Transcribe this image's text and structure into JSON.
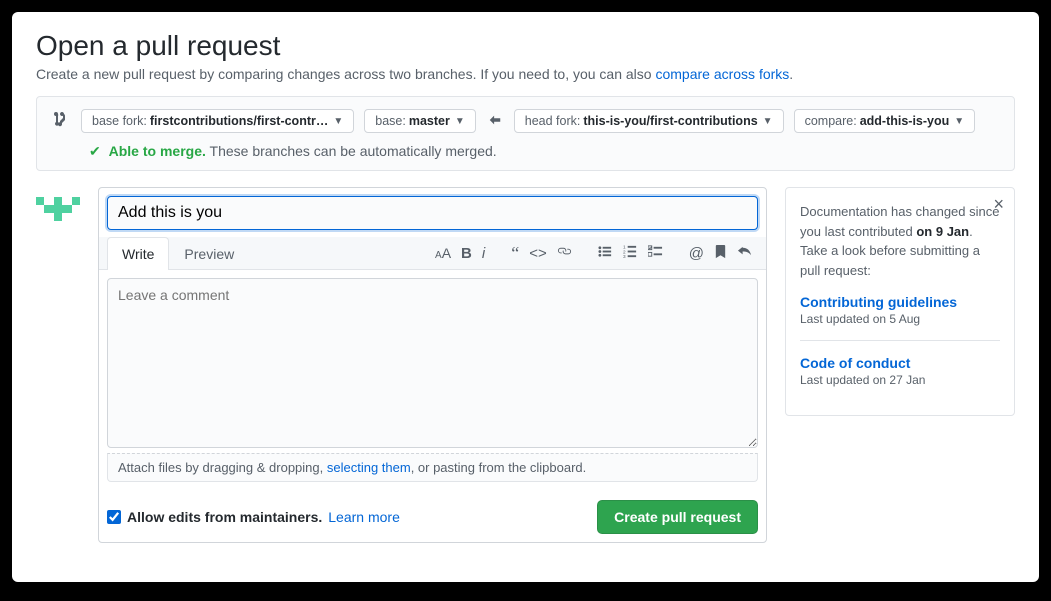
{
  "header": {
    "title": "Open a pull request",
    "subhead_prefix": "Create a new pull request by comparing changes across two branches. If you need to, you can also ",
    "subhead_link": "compare across forks",
    "subhead_suffix": "."
  },
  "compare": {
    "base_fork_label": "base fork:",
    "base_fork_value": "firstcontributions/first-contr…",
    "base_label": "base:",
    "base_value": "master",
    "head_fork_label": "head fork:",
    "head_fork_value": "this-is-you/first-contributions",
    "compare_label": "compare:",
    "compare_value": "add-this-is-you"
  },
  "merge_status": {
    "able_label": "Able to merge.",
    "detail": "These branches can be automatically merged."
  },
  "form": {
    "title_value": "Add this is you",
    "write_tab": "Write",
    "preview_tab": "Preview",
    "comment_placeholder": "Leave a comment",
    "attach_prefix": "Attach files by dragging & dropping, ",
    "attach_link": "selecting them",
    "attach_suffix": ", or pasting from the clipboard.",
    "allow_edits_label": "Allow edits from maintainers.",
    "learn_more": "Learn more",
    "submit_label": "Create pull request"
  },
  "sidebar": {
    "notice_prefix": "Documentation has changed since you last contributed ",
    "notice_bold": "on 9 Jan",
    "notice_suffix": ". Take a look before submitting a pull request:",
    "link1_label": "Contributing guidelines",
    "link1_meta": "Last updated on 5 Aug",
    "link2_label": "Code of conduct",
    "link2_meta": "Last updated on 27 Jan"
  }
}
